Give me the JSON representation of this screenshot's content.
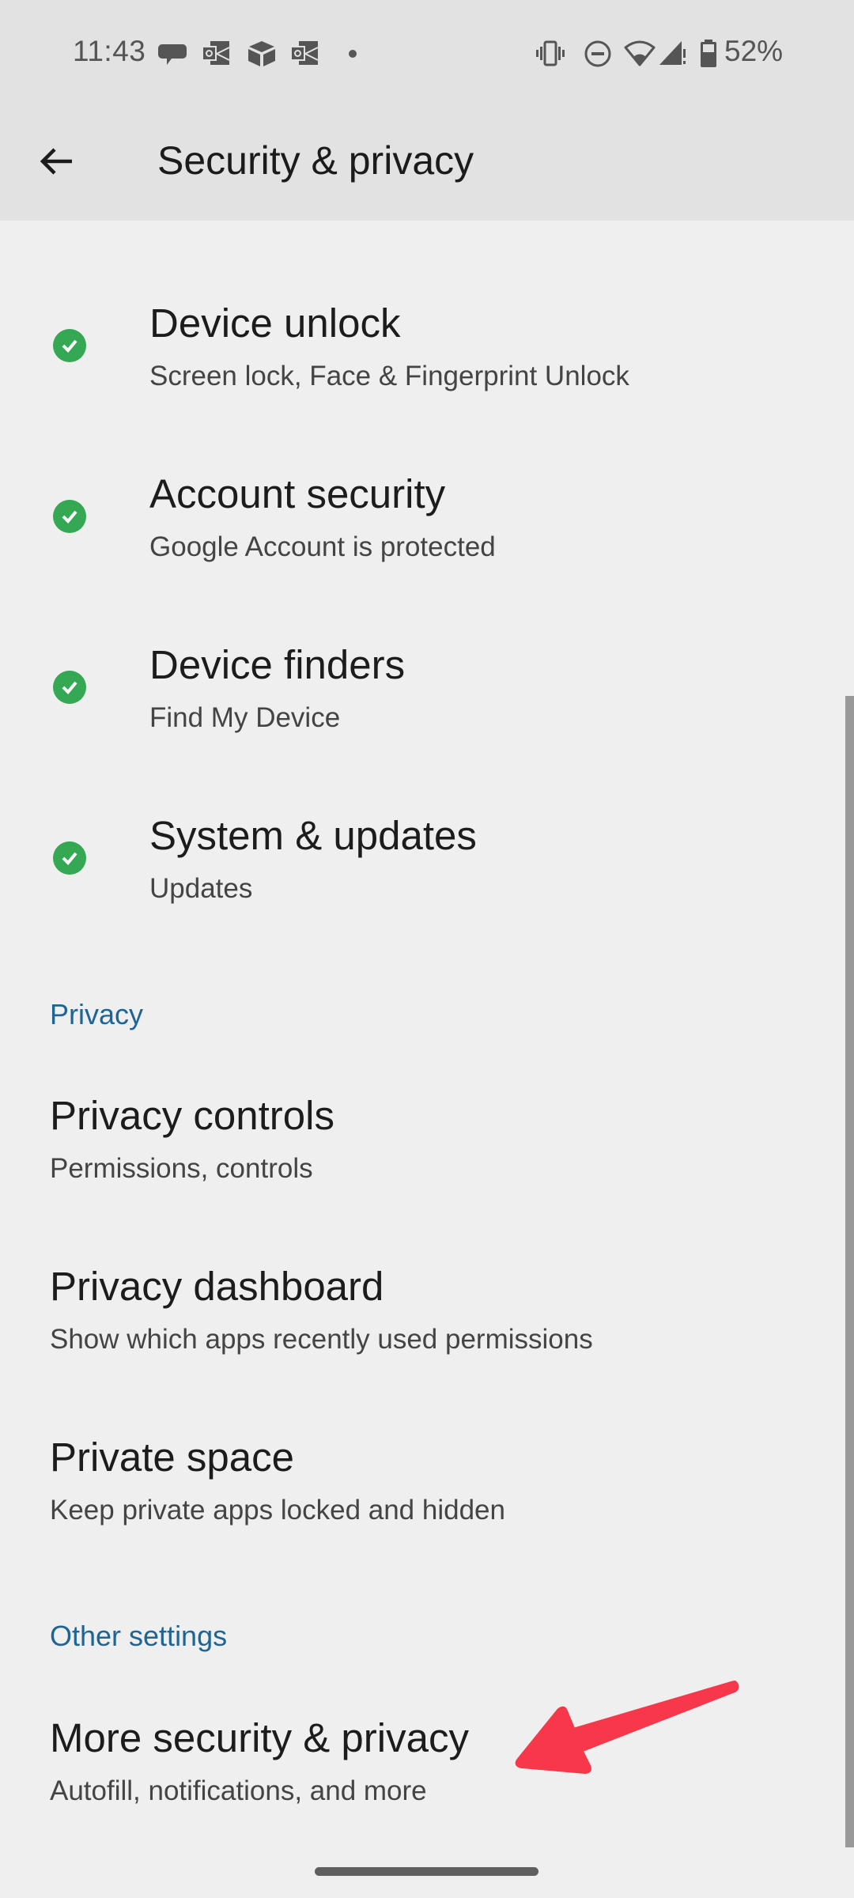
{
  "status_bar": {
    "time": "11:43",
    "notification_icons": [
      "chat-bubble-icon",
      "outlook-icon",
      "box-icon",
      "outlook-icon",
      "more-dot-icon"
    ],
    "system_icons": [
      "vibrate-icon",
      "do-not-disturb-icon",
      "wifi-icon",
      "signal-alert-icon",
      "battery-icon"
    ],
    "battery_percent": "52%"
  },
  "app_bar": {
    "back_icon": "arrow-back-icon",
    "title": "Security & privacy"
  },
  "security_items": [
    {
      "title": "Device unlock",
      "subtitle": "Screen lock, Face & Fingerprint Unlock",
      "status": "ok"
    },
    {
      "title": "Account security",
      "subtitle": "Google Account is protected",
      "status": "ok"
    },
    {
      "title": "Device finders",
      "subtitle": "Find My Device",
      "status": "ok"
    },
    {
      "title": "System & updates",
      "subtitle": "Updates",
      "status": "ok"
    }
  ],
  "sections": {
    "privacy": {
      "header": "Privacy",
      "items": [
        {
          "title": "Privacy controls",
          "subtitle": "Permissions, controls"
        },
        {
          "title": "Privacy dashboard",
          "subtitle": "Show which apps recently used permissions"
        },
        {
          "title": "Private space",
          "subtitle": "Keep private apps locked and hidden"
        }
      ]
    },
    "other": {
      "header": "Other settings",
      "items": [
        {
          "title": "More security & privacy",
          "subtitle": "Autofill, notifications, and more"
        }
      ]
    }
  },
  "colors": {
    "status_ok": "#34a853",
    "section_header": "#1c6594",
    "annotation_arrow": "#f7374a"
  }
}
